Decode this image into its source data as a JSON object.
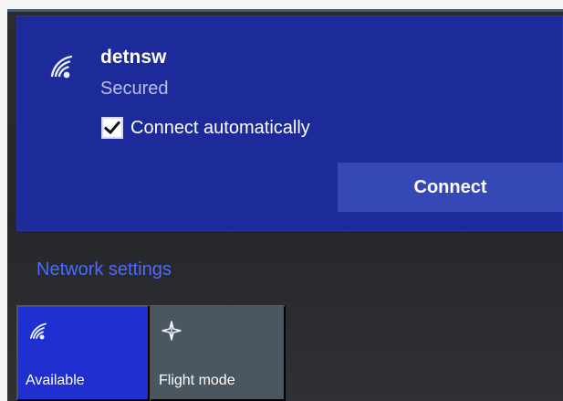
{
  "network": {
    "name": "detnsw",
    "status": "Secured",
    "connect_automatically": {
      "label": "Connect automatically",
      "checked": true
    },
    "connect_button_label": "Connect",
    "icon": "wifi-icon"
  },
  "network_settings_label": "Network settings",
  "quick_actions": [
    {
      "label": "Available",
      "icon": "wifi-icon",
      "active": true
    },
    {
      "label": "Flight mode",
      "icon": "airplane-icon",
      "active": false
    }
  ],
  "colors": {
    "panel_blue": "#1d2a9a",
    "button_blue": "#3648b6",
    "link_blue": "#4f68ff",
    "tile_active": "#1f2fd0",
    "tile_inactive": "#4a5660",
    "flyout_background": "#2a2c30"
  }
}
